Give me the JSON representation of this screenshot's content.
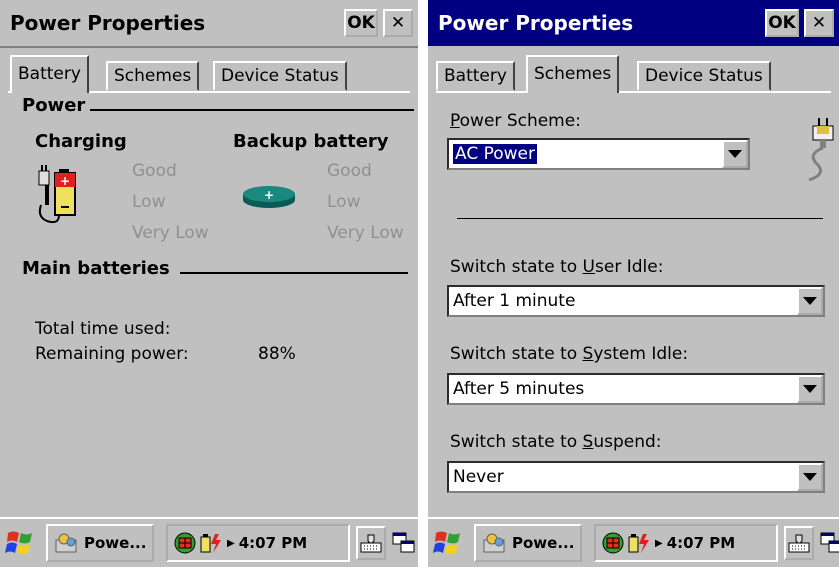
{
  "left": {
    "title": "Power Properties",
    "ok_label": "OK",
    "close_label": "✕",
    "tabs": [
      "Battery",
      "Schemes",
      "Device Status"
    ],
    "active_tab": "Battery",
    "power_header": "Power",
    "charging_label": "Charging",
    "backup_label": "Backup battery",
    "charging_levels": [
      "Good",
      "Low",
      "Very Low"
    ],
    "backup_levels": [
      "Good",
      "Low",
      "Very Low"
    ],
    "main_header": "Main batteries",
    "total_time_label": "Total time used:",
    "remaining_label": "Remaining power:",
    "remaining_value": "88%",
    "taskbar": {
      "app_label": "Powe...",
      "time": "4:07 PM"
    }
  },
  "right": {
    "title": "Power Properties",
    "ok_label": "OK",
    "close_label": "✕",
    "tabs": [
      "Battery",
      "Schemes",
      "Device Status"
    ],
    "active_tab": "Schemes",
    "scheme_label_pre": "",
    "scheme_label_ul": "P",
    "scheme_label_post": "ower Scheme:",
    "scheme_value": "AC Power",
    "user_idle": {
      "pre": "Switch state to ",
      "ul": "U",
      "post": "ser Idle:",
      "value": "After 1 minute"
    },
    "system_idle": {
      "pre": "Switch state to ",
      "ul": "S",
      "post": "ystem Idle:",
      "value": "After 5 minutes"
    },
    "suspend": {
      "pre": "Switch state to ",
      "ul": "S",
      "post": "uspend:",
      "value": "Never"
    },
    "taskbar": {
      "app_label": "Powe...",
      "time": "4:07 PM"
    }
  },
  "colors": {
    "face": "#c0c0c0",
    "active_title": "#000080",
    "disabled_text": "#909090",
    "battery_green": "#1a8a80"
  },
  "icons": [
    "battery-plug-icon",
    "backup-battery-icon",
    "power-plug-icon",
    "start-flag-icon",
    "app-icon",
    "network-icon",
    "battery-tray-icon",
    "keyboard-icon",
    "switch-windows-icon"
  ]
}
